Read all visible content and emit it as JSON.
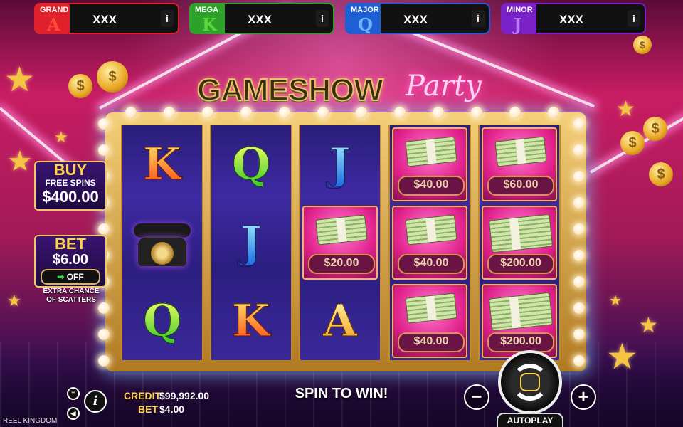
{
  "jackpots": [
    {
      "name": "GRAND",
      "letter": "A",
      "value": "XXX",
      "info": "i",
      "color": "#e0212b",
      "letter_color": "#ff4a3a"
    },
    {
      "name": "MEGA",
      "letter": "K",
      "value": "XXX",
      "info": "i",
      "color": "#2da12a",
      "letter_color": "#5ad83a"
    },
    {
      "name": "MAJOR",
      "letter": "Q",
      "value": "XXX",
      "info": "i",
      "color": "#1f5fd6",
      "letter_color": "#6fb4ff"
    },
    {
      "name": "MINOR",
      "letter": "J",
      "value": "XXX",
      "info": "i",
      "color": "#7a22c8",
      "letter_color": "#c07aff"
    }
  ],
  "logo": {
    "main": "GAMESHOW",
    "script": "Party"
  },
  "buy_panel": {
    "title": "BUY",
    "subtitle": "FREE SPINS",
    "price": "$400.00"
  },
  "bet_panel": {
    "title": "BET",
    "amount": "$6.00",
    "toggle": "OFF",
    "caption_line1": "EXTRA CHANCE",
    "caption_line2": "OF SCATTERS"
  },
  "reels": [
    [
      {
        "type": "letter",
        "symbol": "K"
      },
      {
        "type": "phone",
        "icon": "rotary-phone"
      },
      {
        "type": "letter",
        "symbol": "Q"
      }
    ],
    [
      {
        "type": "letter",
        "symbol": "Q"
      },
      {
        "type": "letter",
        "symbol": "J"
      },
      {
        "type": "letter",
        "symbol": "K"
      }
    ],
    [
      {
        "type": "letter",
        "symbol": "J"
      },
      {
        "type": "money",
        "amount": "$20.00"
      },
      {
        "type": "letter",
        "symbol": "A"
      }
    ],
    [
      {
        "type": "money",
        "amount": "$40.00"
      },
      {
        "type": "money",
        "amount": "$40.00"
      },
      {
        "type": "money",
        "amount": "$40.00"
      }
    ],
    [
      {
        "type": "money",
        "amount": "$60.00"
      },
      {
        "type": "money",
        "amount": "$200.00"
      },
      {
        "type": "money",
        "amount": "$200.00"
      }
    ]
  ],
  "footer": {
    "credit_label": "CREDIT",
    "credit_value": "$99,992.00",
    "bet_label": "BET",
    "bet_value": "$4.00",
    "message": "SPIN TO WIN!",
    "autoplay_label": "AUTOPLAY",
    "brand": "REEL KINGDOM",
    "minus": "−",
    "plus": "+",
    "info": "i"
  }
}
